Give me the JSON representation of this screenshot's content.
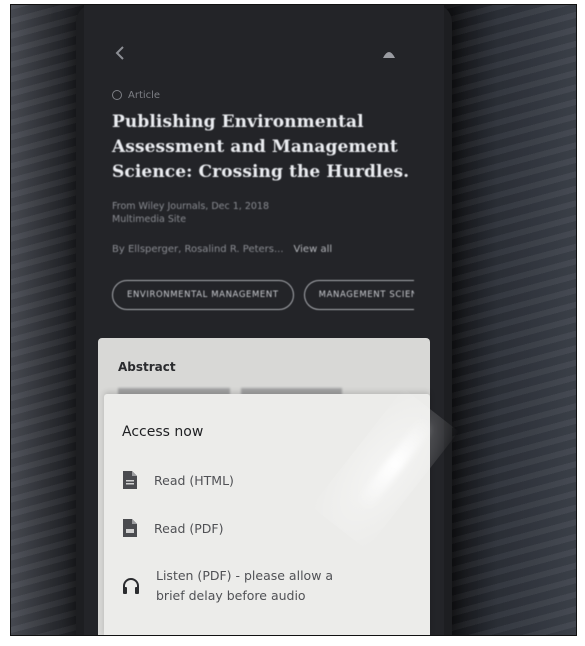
{
  "header": {
    "back_icon": "back-chevron-icon",
    "bookmark_icon": "bookmark-icon"
  },
  "article": {
    "kind_icon": "document-circle-icon",
    "kind_label": "Article",
    "title": "Publishing Environmental Assessment and Management Science: Crossing the Hurdles.",
    "meta_line1": "From Wiley Journals, Dec 1, 2018",
    "meta_line2": "Multimedia Site",
    "authors_label": "By Ellsperger, Rosalind R. Peters...",
    "view_all_label": "View all"
  },
  "chips": [
    {
      "label": "ENVIRONMENTAL MANAGEMENT"
    },
    {
      "label": "MANAGEMENT SCIENCE"
    }
  ],
  "abstract": {
    "heading": "Abstract"
  },
  "access_sheet": {
    "title": "Access now",
    "options": [
      {
        "label": "Read (HTML)",
        "icon": "file-icon"
      },
      {
        "label": "Read (PDF)",
        "icon": "pdf-file-icon"
      },
      {
        "label_line1": "Listen (PDF) - please allow a",
        "label_line2": "brief delay before audio",
        "icon": "headphones-icon"
      }
    ]
  },
  "colors": {
    "screen_bg": "#232428",
    "sheet_bg": "#ececea",
    "abstract_bg": "#d8d8d6",
    "title_text": "#eceef2"
  }
}
